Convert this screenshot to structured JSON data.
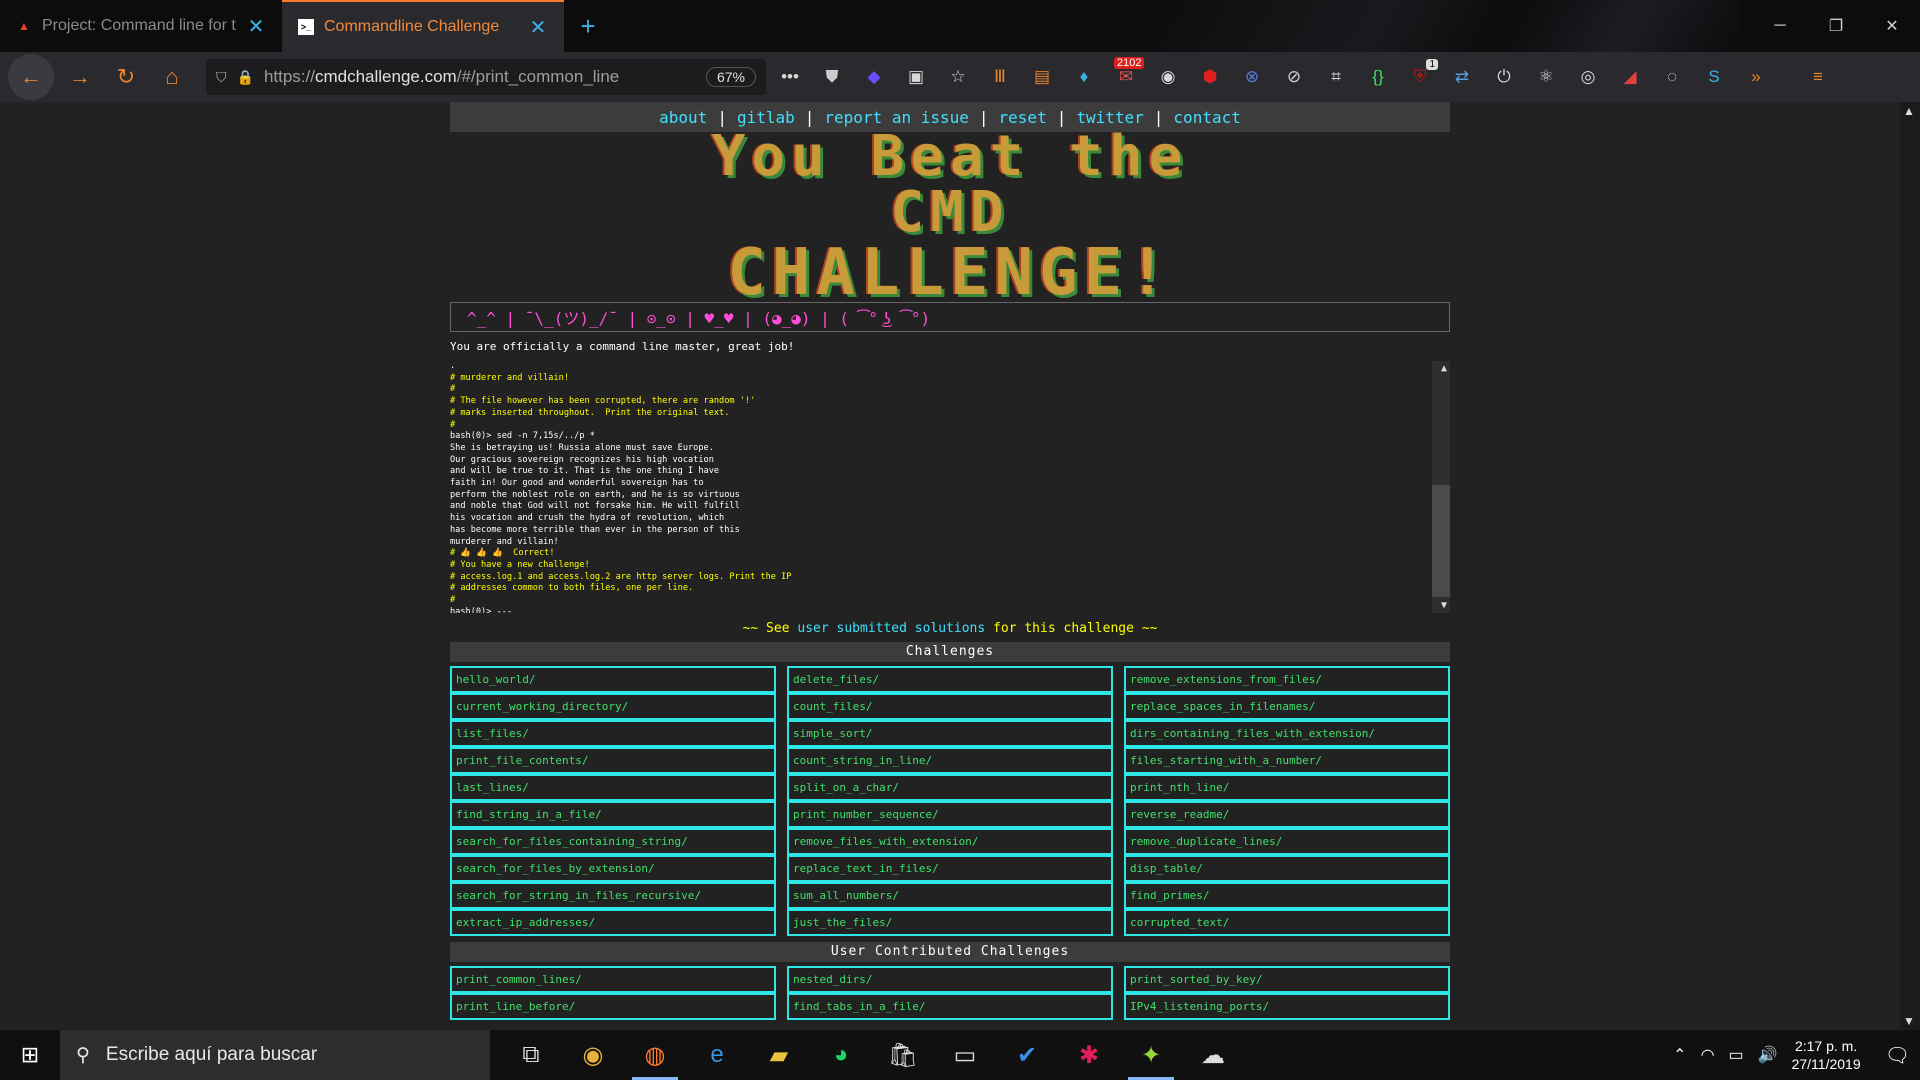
{
  "browser": {
    "tabs": [
      {
        "title": "Project: Command line for the",
        "active": false,
        "icon": "gitlab-icon"
      },
      {
        "title": "Commandline Challenge",
        "active": true,
        "icon": "terminal-icon"
      }
    ],
    "url_prefix": "https://",
    "url_domain": "cmdchallenge.com",
    "url_path": "/#/print_common_line",
    "zoom": "67%",
    "badge_count": "2102",
    "badge_count_small": "1"
  },
  "site": {
    "nav": [
      "about",
      "gitlab",
      "report an issue",
      "reset",
      "twitter",
      "contact"
    ],
    "nav_sep": "|",
    "banner": [
      "You Beat the",
      "CMD",
      "CHALLENGE!"
    ],
    "emojis": "^_^ | ¯\\_(ツ)_/¯ | ⊙_⊙ | ♥_♥ | (◕_◕) | ( ͡° ͜ʖ ͡°)",
    "message": "You are officially a command line master, great job!",
    "terminal_lines": [
      {
        "c": "t-plain",
        "t": "."
      },
      {
        "c": "t-comment",
        "t": "# murderer and villain!"
      },
      {
        "c": "t-comment",
        "t": "#"
      },
      {
        "c": "t-comment",
        "t": "# The file however has been corrupted, there are random '!'"
      },
      {
        "c": "t-comment",
        "t": "# marks inserted throughout.  Print the original text."
      },
      {
        "c": "t-comment",
        "t": "#"
      },
      {
        "c": "t-plain",
        "t": "bash(0)> sed -n 7,15s/../p *"
      },
      {
        "c": "t-plain",
        "t": "She is betraying us! Russia alone must save Europe."
      },
      {
        "c": "t-plain",
        "t": "Our gracious sovereign recognizes his high vocation"
      },
      {
        "c": "t-plain",
        "t": "and will be true to it. That is the one thing I have"
      },
      {
        "c": "t-plain",
        "t": "faith in! Our good and wonderful sovereign has to"
      },
      {
        "c": "t-plain",
        "t": "perform the noblest role on earth, and he is so virtuous"
      },
      {
        "c": "t-plain",
        "t": "and noble that God will not forsake him. He will fulfill"
      },
      {
        "c": "t-plain",
        "t": "his vocation and crush the hydra of revolution, which"
      },
      {
        "c": "t-plain",
        "t": "has become more terrible than ever in the person of this"
      },
      {
        "c": "t-plain",
        "t": "murderer and villain!"
      },
      {
        "c": "t-comment",
        "t": "# 👍 👍 👍  Correct!"
      },
      {
        "c": "t-comment",
        "t": "# You have a new challenge!"
      },
      {
        "c": "t-comment",
        "t": "# access.log.1 and access.log.2 are http server logs. Print the IP"
      },
      {
        "c": "t-comment",
        "t": "# addresses common to both files, one per line."
      },
      {
        "c": "t-comment",
        "t": "#"
      },
      {
        "c": "t-plain",
        "t": "bash(0)> ---"
      }
    ],
    "see_prefix": "~~ See",
    "see_link": "user submitted solutions",
    "see_suffix": "for this challenge ~~",
    "challenges_title": "Challenges",
    "challenges": [
      "hello_world/",
      "delete_files/",
      "remove_extensions_from_files/",
      "current_working_directory/",
      "count_files/",
      "replace_spaces_in_filenames/",
      "list_files/",
      "simple_sort/",
      "dirs_containing_files_with_extension/",
      "print_file_contents/",
      "count_string_in_line/",
      "files_starting_with_a_number/",
      "last_lines/",
      "split_on_a_char/",
      "print_nth_line/",
      "find_string_in_a_file/",
      "print_number_sequence/",
      "reverse_readme/",
      "search_for_files_containing_string/",
      "remove_files_with_extension/",
      "remove_duplicate_lines/",
      "search_for_files_by_extension/",
      "replace_text_in_files/",
      "disp_table/",
      "search_for_string_in_files_recursive/",
      "sum_all_numbers/",
      "find_primes/",
      "extract_ip_addresses/",
      "just_the_files/",
      "corrupted_text/"
    ],
    "user_challenges_title": "User Contributed Challenges",
    "user_challenges": [
      "print_common_lines/",
      "nested_dirs/",
      "print_sorted_by_key/",
      "print_line_before/",
      "find_tabs_in_a_file/",
      "IPv4_listening_ports/"
    ]
  },
  "taskbar": {
    "search_placeholder": "Escribe aquí para buscar",
    "time": "2:17 p. m.",
    "date": "27/11/2019"
  }
}
